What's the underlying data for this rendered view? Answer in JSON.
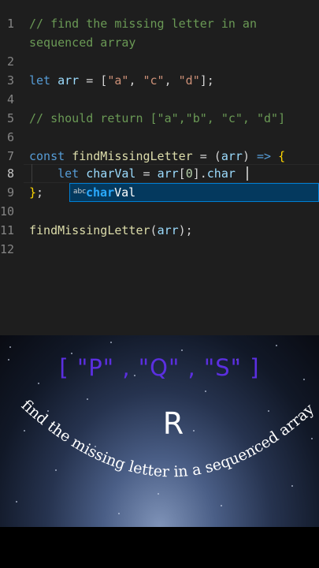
{
  "editor": {
    "lines": [
      {
        "num": "1",
        "tokens": [
          {
            "t": "// find the missing letter in an",
            "c": "comment"
          }
        ]
      },
      {
        "num": "",
        "tokens": [
          {
            "t": "sequenced array",
            "c": "comment"
          }
        ]
      },
      {
        "num": "2",
        "tokens": []
      },
      {
        "num": "3",
        "tokens": [
          {
            "t": "let ",
            "c": "kw"
          },
          {
            "t": "arr",
            "c": "var"
          },
          {
            "t": " = [",
            "c": "punc"
          },
          {
            "t": "\"a\"",
            "c": "str"
          },
          {
            "t": ", ",
            "c": "punc"
          },
          {
            "t": "\"c\"",
            "c": "str"
          },
          {
            "t": ", ",
            "c": "punc"
          },
          {
            "t": "\"d\"",
            "c": "str"
          },
          {
            "t": "];",
            "c": "punc"
          }
        ]
      },
      {
        "num": "4",
        "tokens": []
      },
      {
        "num": "5",
        "tokens": [
          {
            "t": "// should return [\"a\",\"b\", \"c\", \"d\"]",
            "c": "comment"
          }
        ]
      },
      {
        "num": "6",
        "tokens": []
      },
      {
        "num": "7",
        "tokens": [
          {
            "t": "const ",
            "c": "kw"
          },
          {
            "t": "findMissingLetter",
            "c": "fn"
          },
          {
            "t": " = (",
            "c": "punc"
          },
          {
            "t": "arr",
            "c": "var"
          },
          {
            "t": ") ",
            "c": "punc"
          },
          {
            "t": "=>",
            "c": "kw"
          },
          {
            "t": " ",
            "c": "punc"
          },
          {
            "t": "{",
            "c": "brace"
          }
        ]
      },
      {
        "num": "8",
        "tokens": [
          {
            "t": "    ",
            "c": "punc"
          },
          {
            "t": "let ",
            "c": "kw"
          },
          {
            "t": "charVal",
            "c": "var"
          },
          {
            "t": " = ",
            "c": "punc"
          },
          {
            "t": "arr",
            "c": "var"
          },
          {
            "t": "[",
            "c": "punc"
          },
          {
            "t": "0",
            "c": "num"
          },
          {
            "t": "].",
            "c": "punc"
          },
          {
            "t": "char",
            "c": "var"
          }
        ]
      },
      {
        "num": "9",
        "tokens": [
          {
            "t": "}",
            "c": "brace"
          },
          {
            "t": ";",
            "c": "punc"
          }
        ]
      },
      {
        "num": "10",
        "tokens": []
      },
      {
        "num": "11",
        "tokens": [
          {
            "t": "findMissingLetter",
            "c": "fn"
          },
          {
            "t": "(",
            "c": "punc"
          },
          {
            "t": "arr",
            "c": "var"
          },
          {
            "t": ");",
            "c": "punc"
          }
        ]
      },
      {
        "num": "12",
        "tokens": []
      }
    ],
    "suggestion": {
      "kind_icon": "abc",
      "match": "char",
      "rest": "Val"
    }
  },
  "banner": {
    "array_text": "[ \"P\" , \"Q\" , \"S\" ]",
    "answer": "R",
    "caption": "find the missing letter in a sequenced array"
  },
  "colors": {
    "editor_bg": "#1e1e1e",
    "array_text": "#5b2fe0",
    "suggest_bg": "#04395e",
    "suggest_border": "#007fd4"
  }
}
